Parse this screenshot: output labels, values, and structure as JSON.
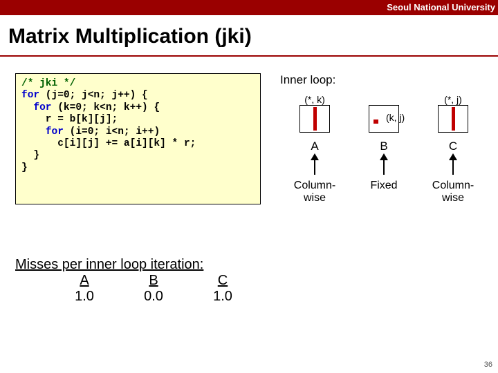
{
  "header": {
    "org": "Seoul National University"
  },
  "title": "Matrix Multiplication (jki)",
  "code": {
    "comment": "/* jki */",
    "l1a": "for",
    "l1b": " (j=0; j<n; j++) {",
    "l2a": "for",
    "l2b": " (k=0; k<n; k++) {",
    "l3": "    r = b[k][j];",
    "l4a": "for",
    "l4b": " (i=0; i<n; i++)",
    "l5": "      c[i][j] += a[i][k] * r;",
    "l6": "  }",
    "l7": "}"
  },
  "diagram": {
    "title": "Inner loop:",
    "idx": {
      "A": "(*, k)",
      "B": "(k, j)",
      "C": "(*, j)"
    },
    "name": {
      "A": "A",
      "B": "B",
      "C": "C"
    },
    "access": {
      "A1": "Column-",
      "A2": "wise",
      "B1": "Fixed",
      "B2": "",
      "C1": "Column-",
      "C2": "wise"
    }
  },
  "misses": {
    "title": "Misses per inner loop iteration:",
    "cols": {
      "A": "A",
      "B": "B",
      "C": "C"
    },
    "vals": {
      "A": "1.0",
      "B": "0.0",
      "C": "1.0"
    }
  },
  "page": "36"
}
